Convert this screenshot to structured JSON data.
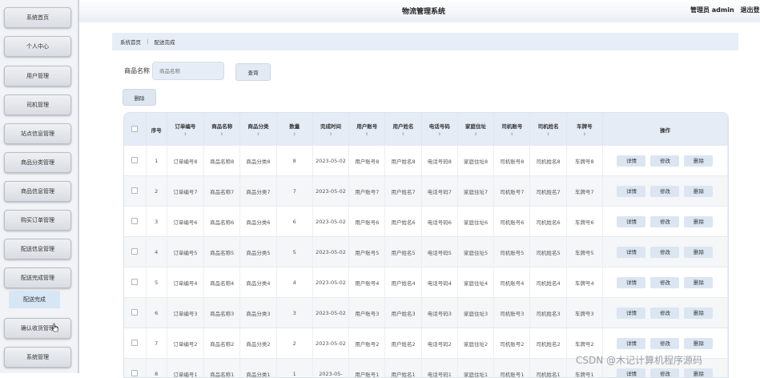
{
  "app": {
    "title": "物流管理系统",
    "user": "管理员 admin",
    "logout": "退出登"
  },
  "sidebar": {
    "items": [
      {
        "label": "系统首页"
      },
      {
        "label": "个人中心"
      },
      {
        "label": "用户管理"
      },
      {
        "label": "司机管理"
      },
      {
        "label": "站点信息管理"
      },
      {
        "label": "商品分类管理"
      },
      {
        "label": "商品信息管理"
      },
      {
        "label": "购买订单管理"
      },
      {
        "label": "配送信息管理"
      },
      {
        "label": "配送完成管理"
      }
    ],
    "sub_item": {
      "label": "配送完成"
    },
    "items_after": [
      {
        "label": "确认收货管理"
      },
      {
        "label": "系统管理"
      }
    ]
  },
  "breadcrumb": {
    "home": "系统首页",
    "current": "配送完成"
  },
  "search": {
    "label": "商品名称",
    "placeholder": "商品名称",
    "button": "查询"
  },
  "toolbar": {
    "delete_label": "删除"
  },
  "table": {
    "columns": [
      {
        "label": ""
      },
      {
        "label": "序号"
      },
      {
        "label": "订单编号",
        "sort": "⇕"
      },
      {
        "label": "商品名称",
        "sort": "⇕"
      },
      {
        "label": "商品分类",
        "sort": "⇕"
      },
      {
        "label": "数量",
        "sort": "⇕"
      },
      {
        "label": "完成时间",
        "sort": "⇕"
      },
      {
        "label": "用户账号",
        "sort": "⇕"
      },
      {
        "label": "用户姓名",
        "sort": "⇕"
      },
      {
        "label": "电话号码",
        "sort": "⇕"
      },
      {
        "label": "家庭住址",
        "sort": "⇕"
      },
      {
        "label": "司机账号",
        "sort": "⇕"
      },
      {
        "label": "司机姓名",
        "sort": "⇕"
      },
      {
        "label": "车牌号",
        "sort": "⇕"
      },
      {
        "label": "操作"
      }
    ],
    "actions": {
      "detail": "详情",
      "edit": "修改",
      "delete": "删除"
    },
    "rows": [
      {
        "idx": "1",
        "order": "订单编号8",
        "product": "商品名称8",
        "category": "商品分类8",
        "qty": "8",
        "time": "2023-05-02",
        "account": "用户账号8",
        "name": "用户姓名8",
        "phone": "电话号码8",
        "address": "家庭住址8",
        "driver_acct": "司机账号8",
        "driver_name": "司机姓名8",
        "plate": "车牌号8"
      },
      {
        "idx": "2",
        "order": "订单编号7",
        "product": "商品名称7",
        "category": "商品分类7",
        "qty": "7",
        "time": "2023-05-02",
        "account": "用户账号7",
        "name": "用户姓名7",
        "phone": "电话号码7",
        "address": "家庭住址7",
        "driver_acct": "司机账号7",
        "driver_name": "司机姓名7",
        "plate": "车牌号7"
      },
      {
        "idx": "3",
        "order": "订单编号6",
        "product": "商品名称6",
        "category": "商品分类6",
        "qty": "6",
        "time": "2023-05-02",
        "account": "用户账号6",
        "name": "用户姓名6",
        "phone": "电话号码6",
        "address": "家庭住址6",
        "driver_acct": "司机账号6",
        "driver_name": "司机姓名6",
        "plate": "车牌号6"
      },
      {
        "idx": "4",
        "order": "订单编号5",
        "product": "商品名称5",
        "category": "商品分类5",
        "qty": "5",
        "time": "2023-05-02",
        "account": "用户账号5",
        "name": "用户姓名5",
        "phone": "电话号码5",
        "address": "家庭住址5",
        "driver_acct": "司机账号5",
        "driver_name": "司机姓名5",
        "plate": "车牌号5"
      },
      {
        "idx": "5",
        "order": "订单编号4",
        "product": "商品名称4",
        "category": "商品分类4",
        "qty": "4",
        "time": "2023-05-02",
        "account": "用户账号4",
        "name": "用户姓名4",
        "phone": "电话号码4",
        "address": "家庭住址4",
        "driver_acct": "司机账号4",
        "driver_name": "司机姓名4",
        "plate": "车牌号4"
      },
      {
        "idx": "6",
        "order": "订单编号3",
        "product": "商品名称3",
        "category": "商品分类3",
        "qty": "3",
        "time": "2023-05-02",
        "account": "用户账号3",
        "name": "用户姓名3",
        "phone": "电话号码3",
        "address": "家庭住址3",
        "driver_acct": "司机账号3",
        "driver_name": "司机姓名3",
        "plate": "车牌号3"
      },
      {
        "idx": "7",
        "order": "订单编号2",
        "product": "商品名称2",
        "category": "商品分类2",
        "qty": "2",
        "time": "2023-05-02",
        "account": "用户账号2",
        "name": "用户姓名2",
        "phone": "电话号码2",
        "address": "家庭住址2",
        "driver_acct": "司机账号2",
        "driver_name": "司机姓名2",
        "plate": "车牌号2"
      },
      {
        "idx": "8",
        "order": "订单编号1",
        "product": "商品名称1",
        "category": "商品分类1",
        "qty": "1",
        "time": "2023-05-",
        "account": "用户账号1",
        "name": "用户姓名1",
        "phone": "电话号码1",
        "address": "家庭住址1",
        "driver_acct": "司机账号1",
        "driver_name": "司机姓名1",
        "plate": "车牌号1"
      }
    ]
  },
  "watermark": "CSDN @木记计算机程序源码",
  "colors": {
    "accent": "#dbe6f2",
    "header_bg": "#e5ecf6",
    "sidebar_bg": "#f1f3f6"
  }
}
